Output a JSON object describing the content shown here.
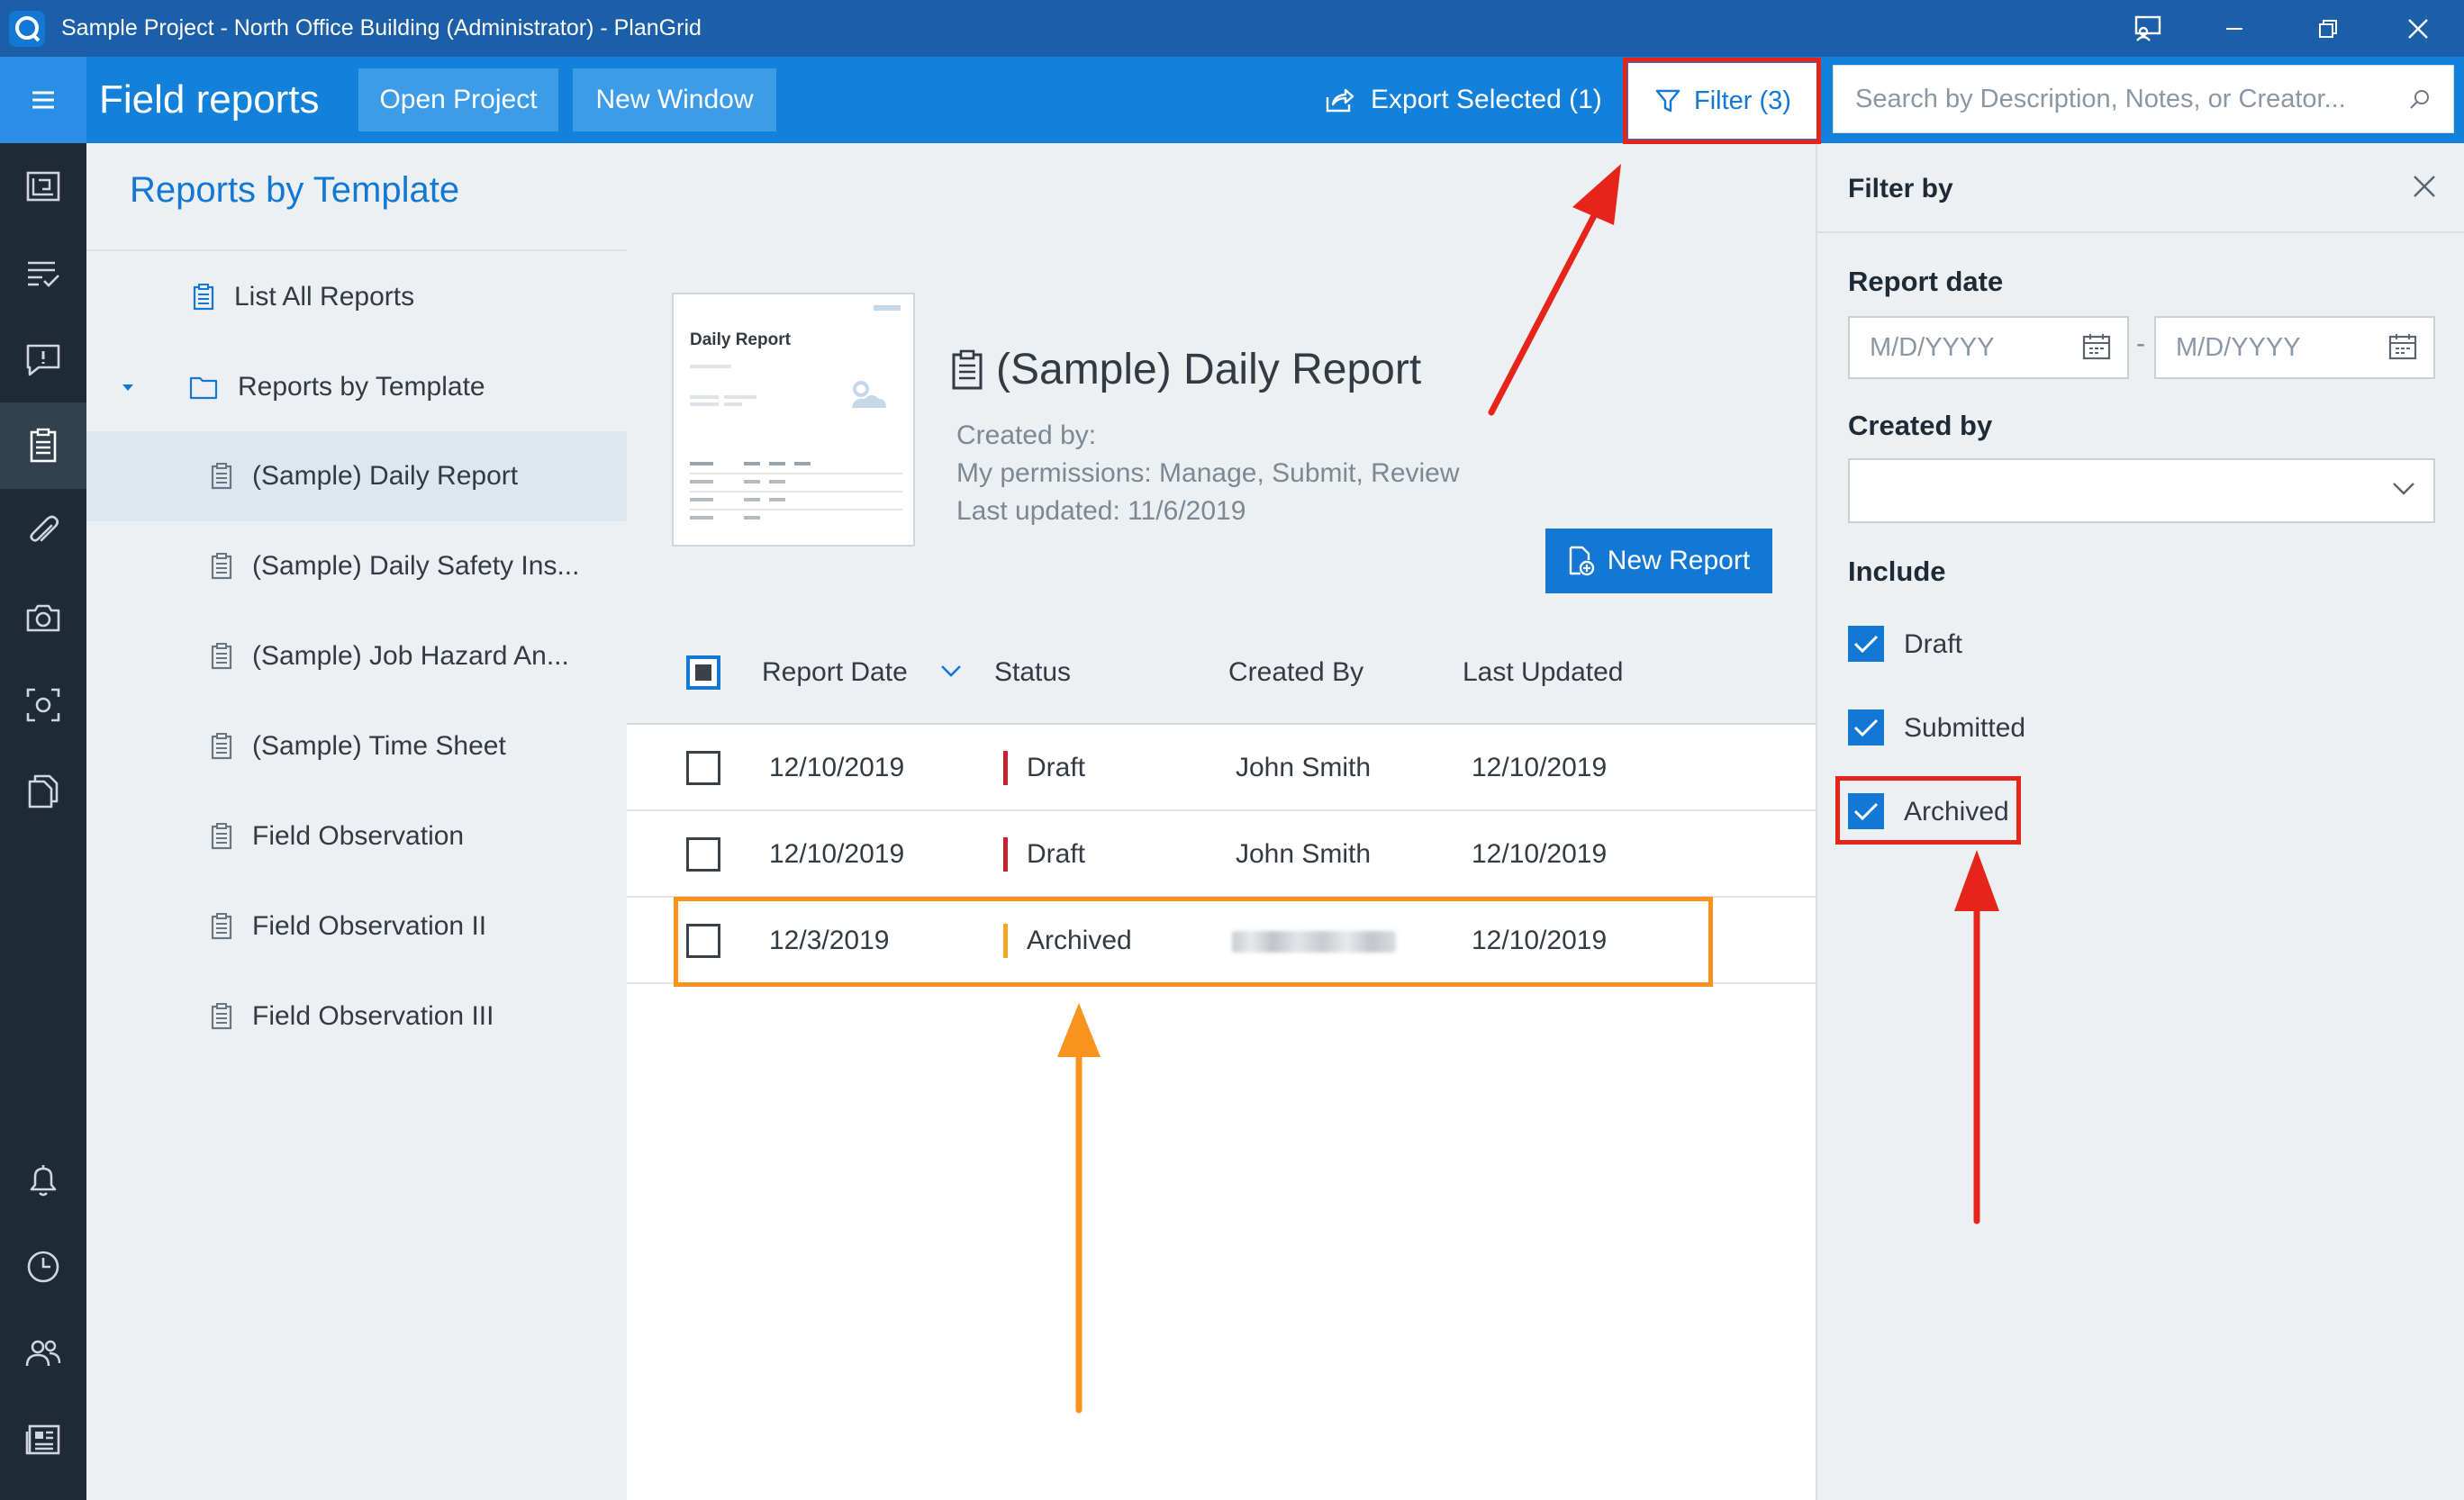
{
  "window": {
    "title": "Sample Project - North Office Building (Administrator) - PlanGrid"
  },
  "header": {
    "page_title": "Field reports",
    "open_project_label": "Open Project",
    "new_window_label": "New Window",
    "export_label": "Export Selected (1)",
    "filter_label": "Filter (3)",
    "search_placeholder": "Search by Description, Notes, or Creator..."
  },
  "leftnav": {
    "icons": [
      "sheets-icon",
      "tasks-icon",
      "issues-icon",
      "field-reports-icon",
      "attachments-icon",
      "camera-icon",
      "capture-icon",
      "documents-icon",
      "bell-icon",
      "clock-icon",
      "team-icon",
      "news-icon"
    ]
  },
  "sidebar": {
    "title": "Reports by Template",
    "items": [
      {
        "label": "List All Reports"
      },
      {
        "label": "Reports by Template"
      },
      {
        "label": "(Sample) Daily Report"
      },
      {
        "label": "(Sample) Daily Safety Ins..."
      },
      {
        "label": "(Sample) Job Hazard An..."
      },
      {
        "label": "(Sample) Time Sheet"
      },
      {
        "label": "Field Observation"
      },
      {
        "label": "Field Observation II"
      },
      {
        "label": "Field Observation III"
      }
    ]
  },
  "template": {
    "thumb_title": "Daily Report",
    "name": "(Sample) Daily Report",
    "created_by": "Created by:",
    "permissions": "My permissions: Manage, Submit, Review",
    "last_updated": "Last updated: 11/6/2019",
    "new_report_label": "New Report"
  },
  "table": {
    "columns": [
      "Report Date",
      "Status",
      "Created By",
      "Last Updated"
    ],
    "rows": [
      {
        "date": "12/10/2019",
        "status": "Draft",
        "status_color": "#c8232c",
        "created_by": "John Smith",
        "last_updated": "12/10/2019"
      },
      {
        "date": "12/10/2019",
        "status": "Draft",
        "status_color": "#c8232c",
        "created_by": "John Smith",
        "last_updated": "12/10/2019"
      },
      {
        "date": "12/3/2019",
        "status": "Archived",
        "status_color": "#f5a623",
        "created_by": "",
        "last_updated": "12/10/2019"
      }
    ]
  },
  "filter_panel": {
    "title": "Filter by",
    "report_date_label": "Report date",
    "date_from_placeholder": "M/D/YYYY",
    "date_separator": "-",
    "date_to_placeholder": "M/D/YYYY",
    "created_by_label": "Created by",
    "include_label": "Include",
    "include": [
      {
        "label": "Draft",
        "checked": true
      },
      {
        "label": "Submitted",
        "checked": true
      },
      {
        "label": "Archived",
        "checked": true
      }
    ]
  },
  "colors": {
    "brand": "#1378d4",
    "titlebar": "#1b5fa8",
    "nav_dark": "#1e2a35",
    "annotation_red": "#e6241a",
    "annotation_orange": "#f8941d"
  }
}
